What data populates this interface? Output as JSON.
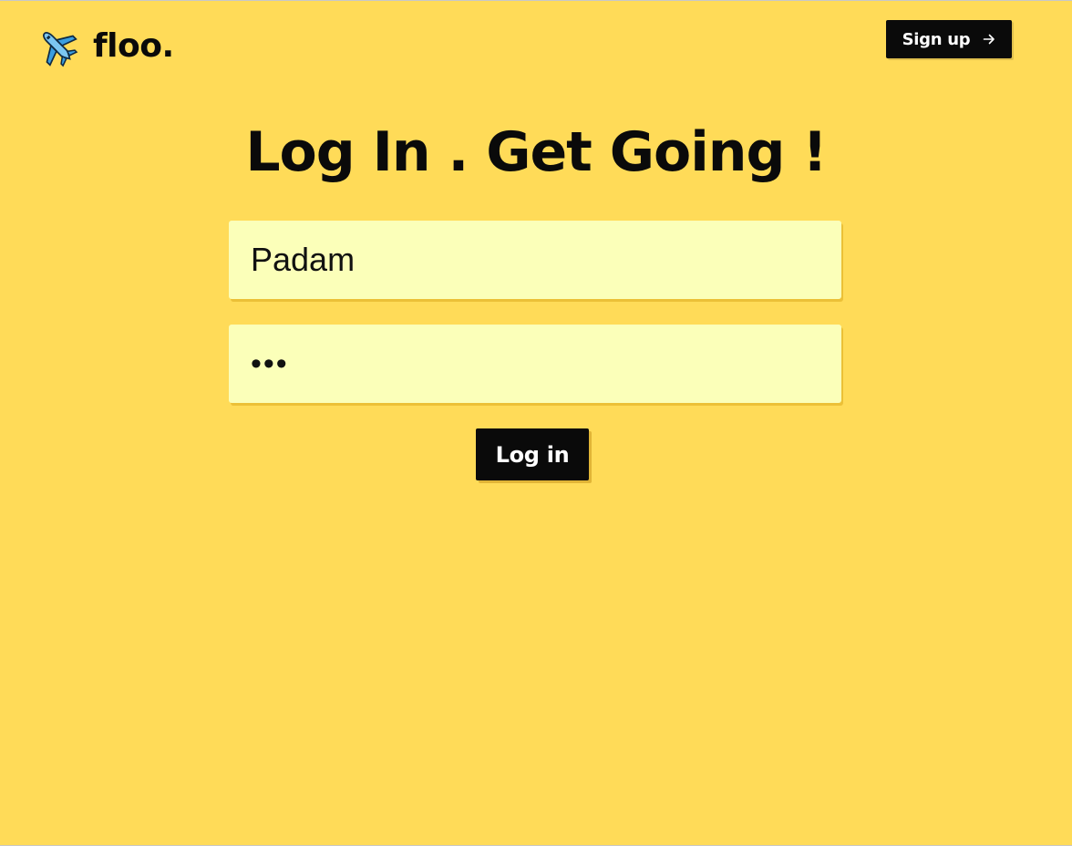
{
  "header": {
    "brand_name": "floo.",
    "brand_icon": "airplane-icon",
    "signup_label": "Sign up",
    "signup_icon": "arrow-right-icon"
  },
  "main": {
    "title": "Log In . Get Going !",
    "username": {
      "value": "Padam"
    },
    "password": {
      "value": "abc"
    },
    "login_label": "Log in"
  },
  "colors": {
    "background": "#ffdb58",
    "input_background": "#fbffb9",
    "button": "#0a0a0a",
    "button_text": "#ffffff",
    "text": "#0a0a0a"
  }
}
